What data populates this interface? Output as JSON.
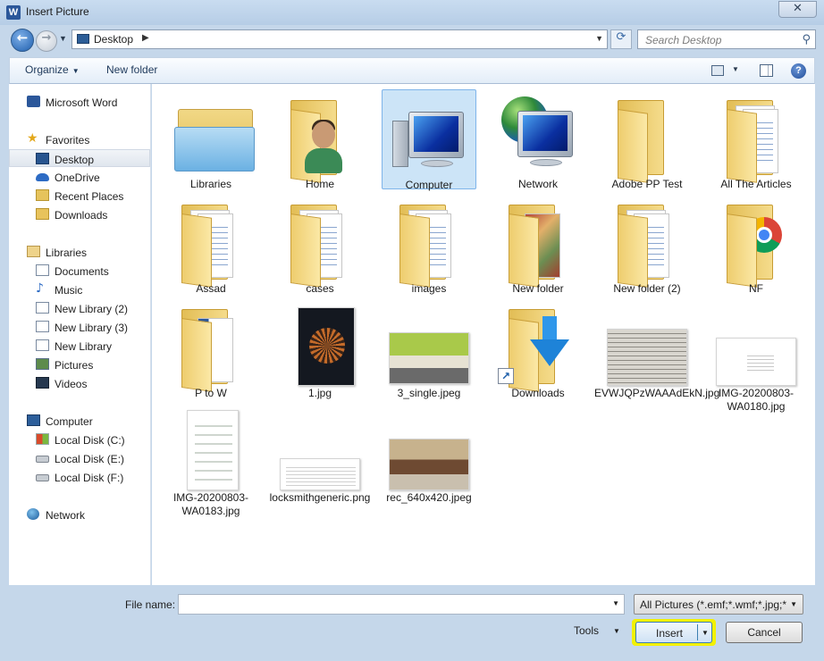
{
  "window": {
    "title": "Insert Picture",
    "close_glyph": "✕"
  },
  "address": {
    "location": "Desktop",
    "search_placeholder": "Search Desktop"
  },
  "toolbar": {
    "organize": "Organize",
    "new_folder": "New folder"
  },
  "nav": {
    "items": [
      {
        "label": "Microsoft Word",
        "icon": "word-icon"
      },
      {
        "label": "Favorites",
        "icon": "star-icon"
      },
      {
        "label": "Desktop",
        "icon": "desktop-icon",
        "selected": true
      },
      {
        "label": "OneDrive",
        "icon": "onedrive-icon"
      },
      {
        "label": "Recent Places",
        "icon": "recent-places-icon"
      },
      {
        "label": "Downloads",
        "icon": "downloads-icon"
      },
      {
        "label": "Libraries",
        "icon": "libraries-icon"
      },
      {
        "label": "Documents",
        "icon": "documents-icon"
      },
      {
        "label": "Music",
        "icon": "music-icon"
      },
      {
        "label": "New Library (2)",
        "icon": "library-icon"
      },
      {
        "label": "New Library (3)",
        "icon": "library-icon"
      },
      {
        "label": "New Library",
        "icon": "library-icon"
      },
      {
        "label": "Pictures",
        "icon": "pictures-icon"
      },
      {
        "label": "Videos",
        "icon": "videos-icon"
      },
      {
        "label": "Computer",
        "icon": "computer-icon"
      },
      {
        "label": "Local Disk (C:)",
        "icon": "windows-disk-icon"
      },
      {
        "label": "Local Disk (E:)",
        "icon": "disk-icon"
      },
      {
        "label": "Local Disk (F:)",
        "icon": "disk-icon"
      },
      {
        "label": "Network",
        "icon": "network-icon"
      }
    ]
  },
  "files": [
    {
      "label": "Libraries",
      "type": "libraries"
    },
    {
      "label": "Home",
      "type": "user-folder"
    },
    {
      "label": "Computer",
      "type": "computer",
      "selected": true
    },
    {
      "label": "Network",
      "type": "network"
    },
    {
      "label": "Adobe PP Test",
      "type": "folder"
    },
    {
      "label": "All The Articles",
      "type": "folder-docs"
    },
    {
      "label": "Assad",
      "type": "folder-docs"
    },
    {
      "label": "cases",
      "type": "folder-docs"
    },
    {
      "label": "images",
      "type": "folder-docs"
    },
    {
      "label": "New folder",
      "type": "folder-image"
    },
    {
      "label": "New folder (2)",
      "type": "folder-docs"
    },
    {
      "label": "NF",
      "type": "folder-chrome"
    },
    {
      "label": "P to W",
      "type": "folder-blue"
    },
    {
      "label": "1.jpg",
      "type": "image-poster"
    },
    {
      "label": "3_single.jpeg",
      "type": "image-room"
    },
    {
      "label": "Downloads",
      "type": "downloads-shortcut"
    },
    {
      "label": "EVWJQPzWAAAdEkN.jpg",
      "type": "image-newspaper"
    },
    {
      "label": "IMG-20200803-WA0180.jpg",
      "type": "image-doc-wide"
    },
    {
      "label": "IMG-20200803-WA0183.jpg",
      "type": "image-doc-tall"
    },
    {
      "label": "locksmithgeneric.png",
      "type": "image-doc-text"
    },
    {
      "label": "rec_640x420.jpeg",
      "type": "image-hall"
    }
  ],
  "bottom": {
    "file_name_label": "File name:",
    "file_name_value": "",
    "filter": "All Pictures (*.emf;*.wmf;*.jpg;*",
    "tools": "Tools",
    "insert": "Insert",
    "cancel": "Cancel"
  },
  "colors": {
    "selection": "#cce4f7",
    "insert_highlight": "#f3f100",
    "window_frame": "#c5d7ea"
  }
}
